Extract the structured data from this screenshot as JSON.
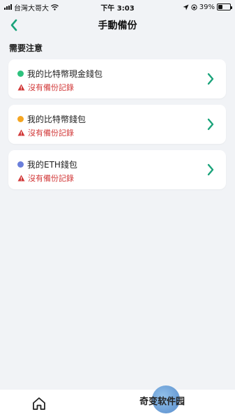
{
  "status_bar": {
    "carrier": "台灣大哥大",
    "time": "下午 3:03",
    "battery": "39%",
    "battery_level": 0.39
  },
  "header": {
    "title": "手動備份"
  },
  "section": {
    "title": "需要注意"
  },
  "wallets": [
    {
      "name": "我的比特幣現金錢包",
      "status": "沒有備份記錄",
      "dot_color": "#2ec27e"
    },
    {
      "name": "我的比特幣錢包",
      "status": "沒有備份記錄",
      "dot_color": "#f5a623"
    },
    {
      "name": "我的ETH錢包",
      "status": "沒有備份記錄",
      "dot_color": "#6a7fdb"
    }
  ],
  "colors": {
    "accent": "#1aa37a",
    "warning": "#d23a3a",
    "background": "#f1f3f6"
  },
  "watermark": {
    "text": "奇变软件园"
  }
}
